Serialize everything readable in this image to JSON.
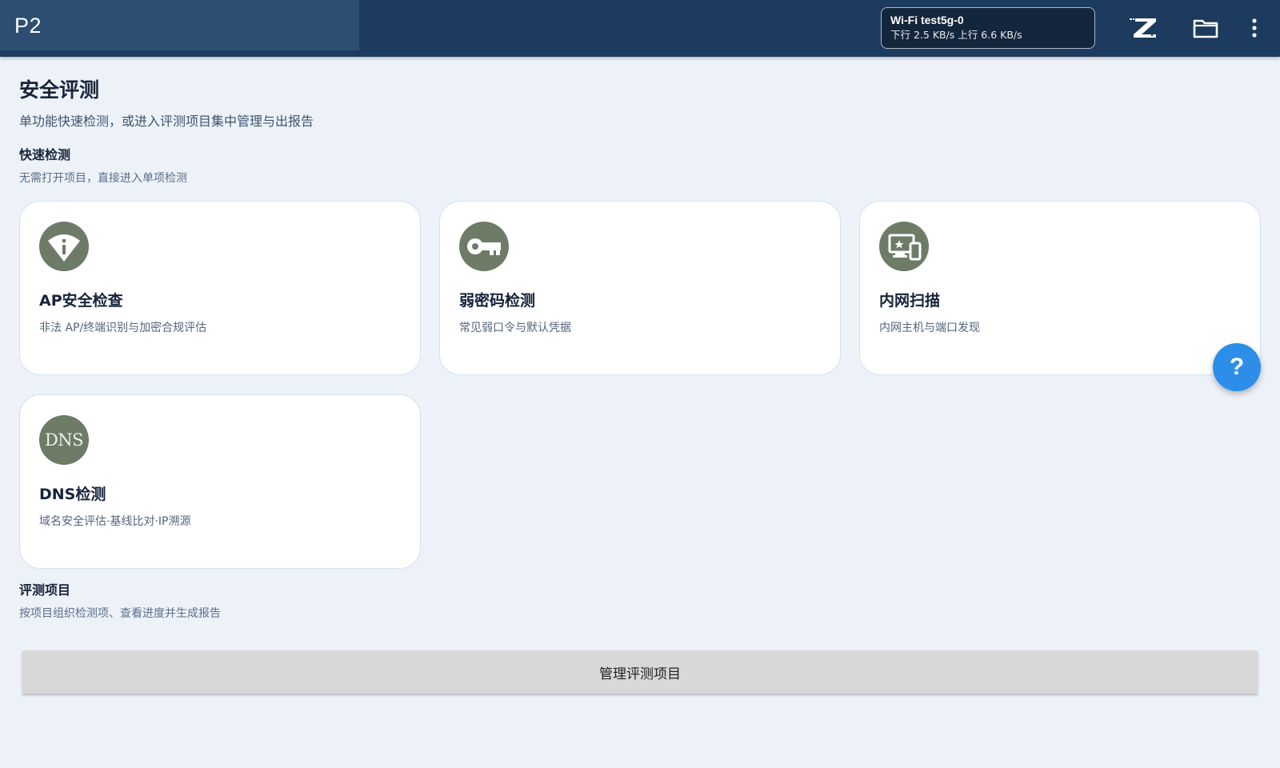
{
  "app": {
    "title": "P2"
  },
  "topbar": {
    "wifi_name": "Wi-Fi test5g-0",
    "wifi_speed": "下行 2.5 KB/s 上行 6.6 KB/s",
    "icons": [
      "brand-z-icon",
      "folder-icon",
      "more-vert-icon"
    ]
  },
  "page": {
    "title": "安全评测",
    "subtitle": "单功能快速检测，或进入评测项目集中管理与出报告"
  },
  "quick_check": {
    "title": "快速检测",
    "subtitle": "无需打开项目，直接进入单项检测",
    "cards": [
      {
        "title": "AP安全检查",
        "desc": "非法 AP/终端识别与加密合规评估",
        "icon": "wifi-info-icon"
      },
      {
        "title": "弱密码检测",
        "desc": "常见弱口令与默认凭据",
        "icon": "key-icon"
      },
      {
        "title": "内网扫描",
        "desc": "内网主机与端口发现",
        "icon": "devices-icon"
      },
      {
        "title": "DNS检测",
        "desc": "域名安全评估·基线比对·IP溯源",
        "icon": "dns-icon",
        "icon_text": "DNS"
      }
    ]
  },
  "projects": {
    "title": "评测项目",
    "subtitle": "按项目组织检测项、查看进度并生成报告",
    "button_label": "管理评测项目"
  },
  "help": {
    "label": "?"
  },
  "colors": {
    "topbar": "#1c3b5e",
    "title_block": "#2d4e70",
    "background": "#edf2f9",
    "card_icon": "#6d7b67",
    "fab": "#2c8ee8",
    "button": "#d8d8d8"
  }
}
